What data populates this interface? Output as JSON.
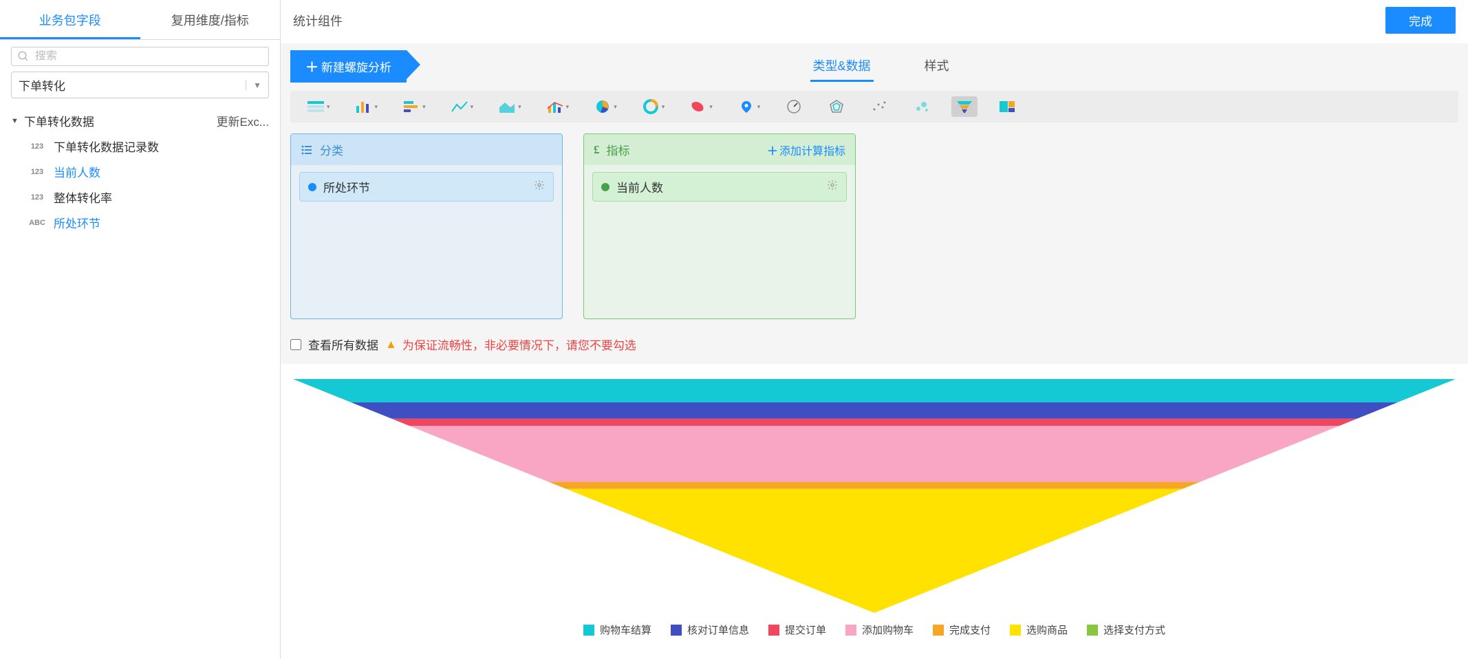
{
  "sidebar": {
    "tabs": {
      "fields": "业务包字段",
      "reuse": "复用维度/指标"
    },
    "search_placeholder": "搜索",
    "select_value": "下单转化",
    "tree_root": "下单转化数据",
    "tree_root_action": "更新Exc...",
    "fields": [
      {
        "type": "123",
        "label": "下单转化数据记录数",
        "used": false
      },
      {
        "type": "123",
        "label": "当前人数",
        "used": true
      },
      {
        "type": "123",
        "label": "整体转化率",
        "used": false
      },
      {
        "type": "ABC",
        "label": "所处环节",
        "used": true
      }
    ]
  },
  "header": {
    "title": "统计组件",
    "done": "完成"
  },
  "config": {
    "new_button": "新建螺旋分析",
    "tabs": {
      "type_data": "类型&数据",
      "style": "样式"
    },
    "category": {
      "title": "分类",
      "chip": "所处环节"
    },
    "metric": {
      "title": "指标",
      "add_label": "添加计算指标",
      "chip": "当前人数"
    },
    "viewall_label": "查看所有数据",
    "warning": "为保证流畅性，非必要情况下，请您不要勾选"
  },
  "chart_data": {
    "type": "funnel",
    "series": [
      {
        "name": "购物车结算",
        "color": "#14c8d4",
        "value": 100
      },
      {
        "name": "核对订单信息",
        "color": "#3f4ec2",
        "value": 90
      },
      {
        "name": "提交订单",
        "color": "#f2465c",
        "value": 83
      },
      {
        "name": "添加购物车",
        "color": "#f9a6c5",
        "value": 80
      },
      {
        "name": "完成支付",
        "color": "#f6a623",
        "value": 56
      },
      {
        "name": "选购商品",
        "color": "#ffe200",
        "value": 53
      },
      {
        "name": "选择支付方式",
        "color": "#89c541",
        "value": 0
      }
    ]
  }
}
